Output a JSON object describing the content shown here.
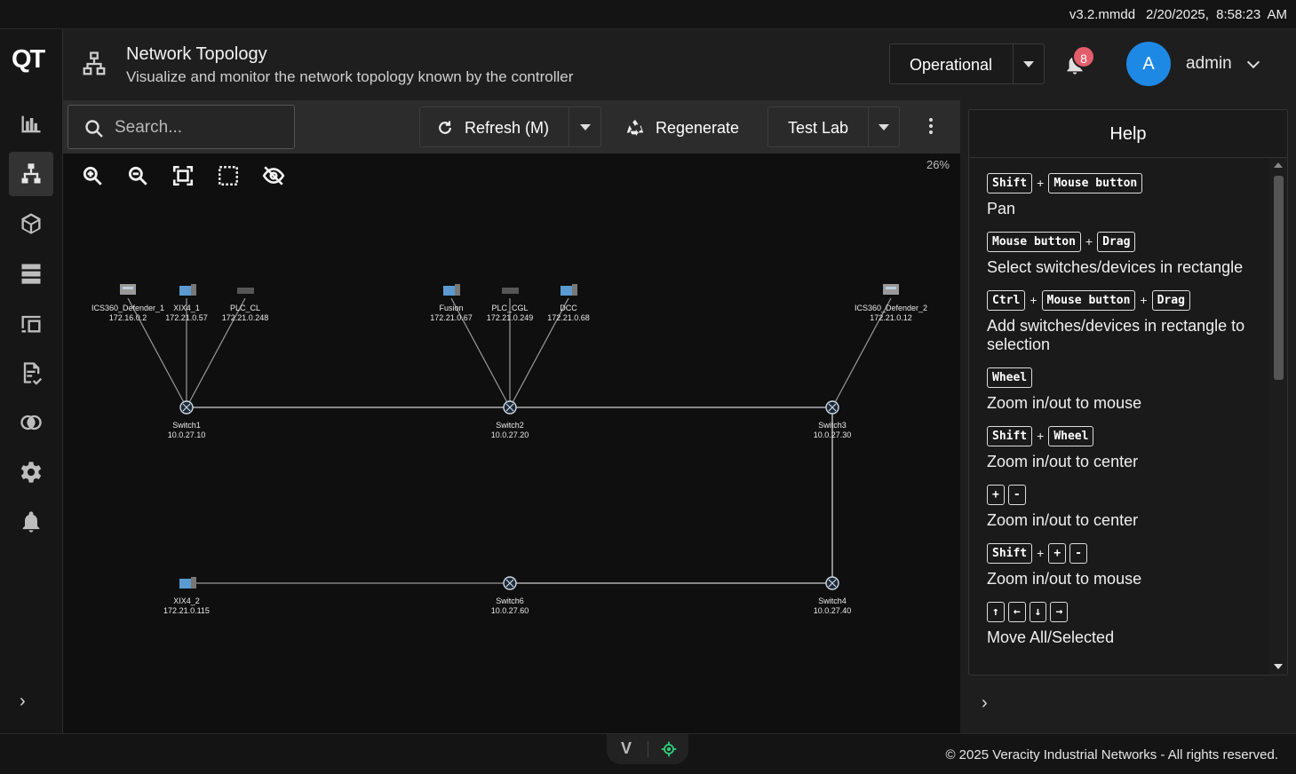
{
  "topbar": {
    "version": "v3.2.mmdd",
    "datetime": "2/20/2025, 8:58:23 AM"
  },
  "brand": {
    "logo_text": "QT"
  },
  "header": {
    "title": "Network Topology",
    "subtitle": "Visualize and monitor the network topology known by the controller",
    "mode": "Operational",
    "notifications": "8",
    "avatar_letter": "A",
    "username": "admin"
  },
  "sidebar": {
    "items": [
      {
        "icon": "chart-icon"
      },
      {
        "icon": "topology-icon",
        "active": true
      },
      {
        "icon": "cube-icon"
      },
      {
        "icon": "servers-icon"
      },
      {
        "icon": "devices-icon"
      },
      {
        "icon": "policy-icon"
      },
      {
        "icon": "overlap-icon"
      },
      {
        "icon": "gear-icon"
      },
      {
        "icon": "bell-icon"
      }
    ],
    "expand": "›"
  },
  "toolbar": {
    "search_placeholder": "Search...",
    "refresh_label": "Refresh (M)",
    "regenerate_label": "Regenerate",
    "lab_label": "Test Lab"
  },
  "canvas": {
    "zoom_percent": "26%",
    "nodes": [
      {
        "id": "ics1",
        "name": "ICS360_Defender_1",
        "ip": "172.16.0.2",
        "kind": "server"
      },
      {
        "id": "xix41",
        "name": "XIX4_1",
        "ip": "172.21.0.57",
        "kind": "pc"
      },
      {
        "id": "plccl",
        "name": "PLC_CL",
        "ip": "172.21.0.248",
        "kind": "plc"
      },
      {
        "id": "fusion",
        "name": "Fusion",
        "ip": "172.21.0.67",
        "kind": "pc"
      },
      {
        "id": "plccgl",
        "name": "PLC_CGL",
        "ip": "172.21.0.249",
        "kind": "plc"
      },
      {
        "id": "dcc",
        "name": "DCC",
        "ip": "172.21.0.68",
        "kind": "pc"
      },
      {
        "id": "ics2",
        "name": "ICS360_Defender_2",
        "ip": "172.21.0.12",
        "kind": "server"
      },
      {
        "id": "sw1",
        "name": "Switch1",
        "ip": "10.0.27.10",
        "kind": "switch"
      },
      {
        "id": "sw2",
        "name": "Switch2",
        "ip": "10.0.27.20",
        "kind": "switch"
      },
      {
        "id": "sw3",
        "name": "Switch3",
        "ip": "10.0.27.30",
        "kind": "switch"
      },
      {
        "id": "xix42",
        "name": "XIX4_2",
        "ip": "172.21.0.115",
        "kind": "pc"
      },
      {
        "id": "sw6",
        "name": "Switch6",
        "ip": "10.0.27.60",
        "kind": "switch"
      },
      {
        "id": "sw4",
        "name": "Switch4",
        "ip": "10.0.27.40",
        "kind": "switch"
      }
    ]
  },
  "help": {
    "title": "Help",
    "items": [
      {
        "keys": [
          "Shift",
          "Mouse button"
        ],
        "desc": "Pan"
      },
      {
        "keys": [
          "Mouse button",
          "Drag"
        ],
        "desc": "Select switches/devices in rectangle"
      },
      {
        "keys": [
          "Ctrl",
          "Mouse button",
          "Drag"
        ],
        "desc": "Add switches/devices in rectangle to selection"
      },
      {
        "keys": [
          "Wheel"
        ],
        "desc": "Zoom in/out to mouse"
      },
      {
        "keys": [
          "Shift",
          "Wheel"
        ],
        "desc": "Zoom in/out to center"
      },
      {
        "keys": [
          "+",
          "-"
        ],
        "desc": "Zoom in/out to center",
        "joined": true
      },
      {
        "keys": [
          "Shift",
          "+",
          "-"
        ],
        "desc": "Zoom in/out to mouse",
        "joined_tail": true
      },
      {
        "keys": [
          "↑",
          "←",
          "↓",
          "→"
        ],
        "desc": "Move All/Selected",
        "joined": true
      }
    ]
  },
  "footer": {
    "copyright": "© 2025 Veracity Industrial Networks - All rights reserved."
  }
}
